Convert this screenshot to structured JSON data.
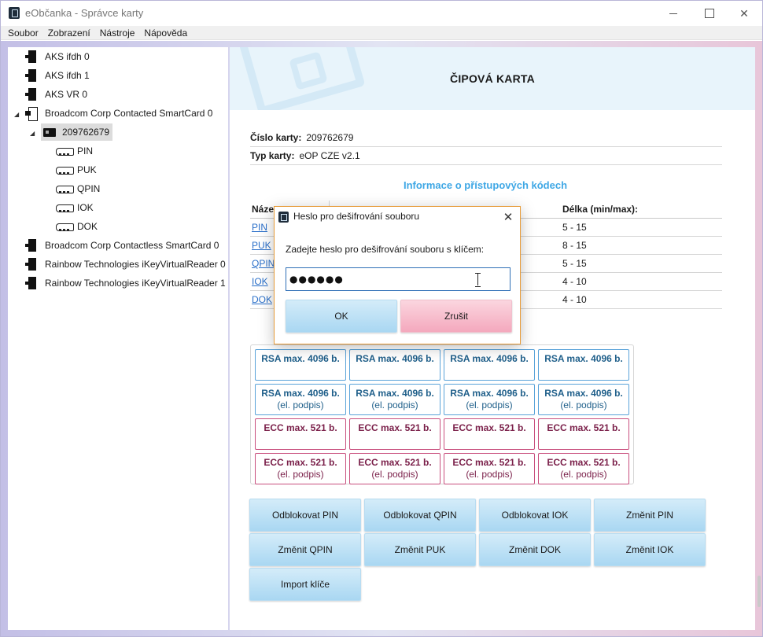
{
  "window": {
    "title": "eObčanka - Správce karty"
  },
  "menu": [
    "Soubor",
    "Zobrazení",
    "Nástroje",
    "Nápověda"
  ],
  "tree": {
    "readers_top": [
      "AKS ifdh 0",
      "AKS ifdh 1",
      "AKS VR 0"
    ],
    "contacted_reader": "Broadcom Corp Contacted SmartCard 0",
    "card": "209762679",
    "codes": [
      "PIN",
      "PUK",
      "QPIN",
      "IOK",
      "DOK"
    ],
    "readers_bottom": [
      "Broadcom Corp Contactless SmartCard 0",
      "Rainbow Technologies iKeyVirtualReader 0",
      "Rainbow Technologies iKeyVirtualReader 1"
    ]
  },
  "main": {
    "title": "ČIPOVÁ KARTA",
    "card_number_label": "Číslo karty:",
    "card_number": "209762679",
    "card_type_label": "Typ karty:",
    "card_type": "eOP CZE v2.1",
    "codes_heading": "Informace o přístupových kódech",
    "codes_header": {
      "name": "Náze",
      "length": "Délka (min/max):"
    },
    "codes": [
      {
        "name": "PIN",
        "length": "5 - 15"
      },
      {
        "name": "PUK",
        "length": "8 - 15"
      },
      {
        "name": "QPIN",
        "length": "5 - 15"
      },
      {
        "name": "IOK",
        "length": "4 - 10"
      },
      {
        "name": "DOK",
        "length": "4 - 10"
      }
    ],
    "keys": {
      "rsa": "RSA max. 4096 b.",
      "ecc": "ECC max. 521 b.",
      "sign_suffix": "(el. podpis)"
    },
    "buttons": [
      "Odblokovat PIN",
      "Odblokovat QPIN",
      "Odblokovat IOK",
      "Změnit PIN",
      "Změnit QPIN",
      "Změnit PUK",
      "Změnit DOK",
      "Změnit IOK",
      "Import klíče"
    ]
  },
  "dialog": {
    "title": "Heslo pro dešifrování souboru",
    "prompt": "Zadejte heslo pro dešifrování souboru s klíčem:",
    "password_value": "●●●●●●",
    "ok_label": "OK",
    "cancel_label": "Zrušit",
    "close_symbol": "✕"
  }
}
